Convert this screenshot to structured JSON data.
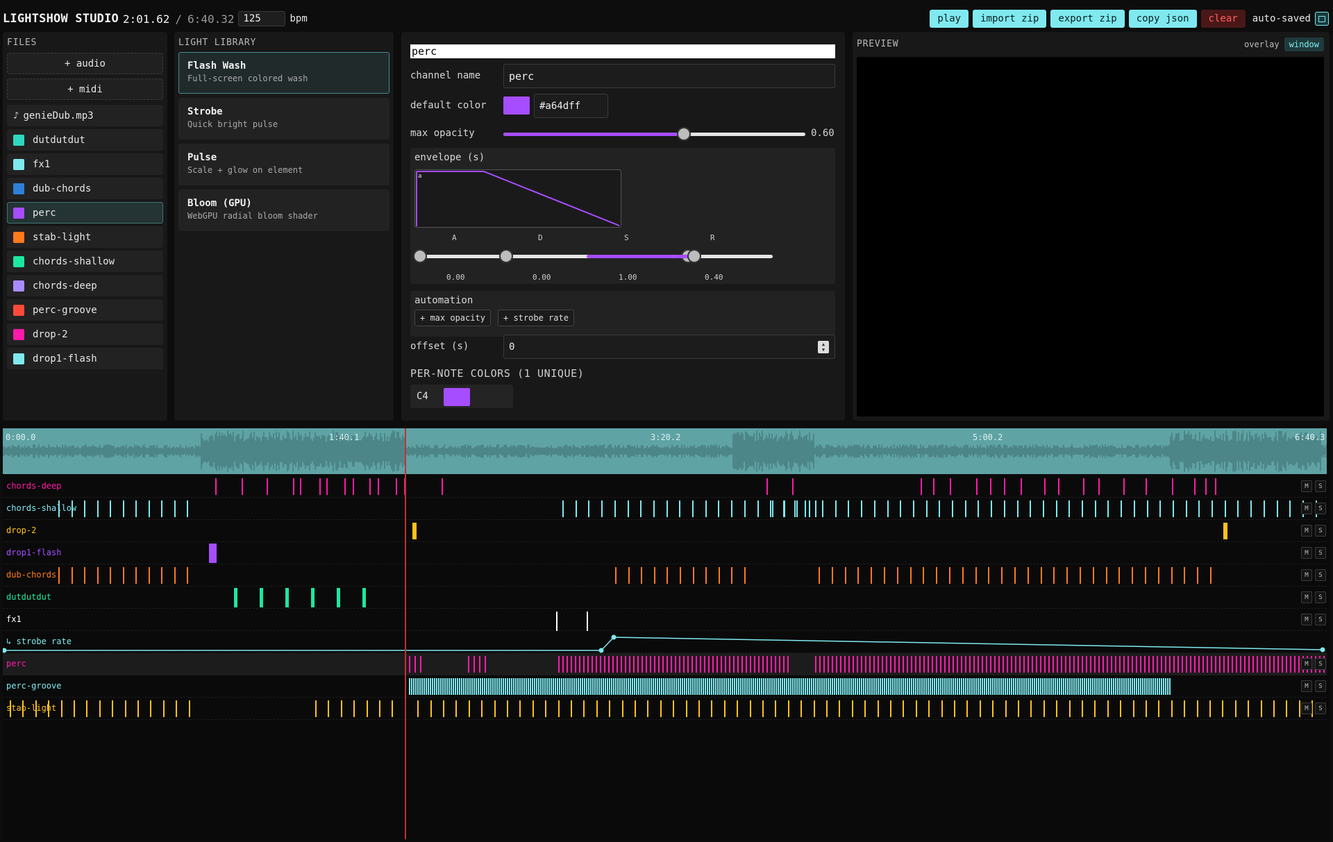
{
  "app": {
    "title": "LIGHTSHOW STUDIO",
    "current_time": "2:01.62",
    "separator": "/",
    "total_time": "6:40.32",
    "bpm": "125",
    "bpm_label": "bpm"
  },
  "toolbar": {
    "play": "play",
    "import_zip": "import zip",
    "export_zip": "export zip",
    "copy_json": "copy json",
    "clear": "clear",
    "status": "auto-saved"
  },
  "files": {
    "title": "FILES",
    "add_audio": "+ audio",
    "add_midi": "+ midi",
    "audio_file": "genieDub.mp3",
    "channels": [
      {
        "name": "dutdutdut",
        "color": "#2fd8c0"
      },
      {
        "name": "fx1",
        "color": "#7fe9ef"
      },
      {
        "name": "dub-chords",
        "color": "#2f7fd8"
      },
      {
        "name": "perc",
        "color": "#a64dff",
        "selected": true
      },
      {
        "name": "stab-light",
        "color": "#ff7a1a"
      },
      {
        "name": "chords-shallow",
        "color": "#1ce8a0"
      },
      {
        "name": "chords-deep",
        "color": "#a98bff"
      },
      {
        "name": "perc-groove",
        "color": "#ff4a3a"
      },
      {
        "name": "drop-2",
        "color": "#ff1aa8"
      },
      {
        "name": "drop1-flash",
        "color": "#7fe9ef"
      }
    ]
  },
  "library": {
    "title": "LIGHT LIBRARY",
    "items": [
      {
        "name": "Flash Wash",
        "desc": "Full-screen colored wash"
      },
      {
        "name": "Strobe",
        "desc": "Quick bright pulse"
      },
      {
        "name": "Pulse",
        "desc": "Scale + glow on element"
      },
      {
        "name": "Bloom (GPU)",
        "desc": "WebGPU radial bloom shader"
      }
    ]
  },
  "editor": {
    "header": "perc",
    "channel_name_label": "channel name",
    "channel_name": "perc",
    "default_color_label": "default color",
    "default_color": "#a64dff",
    "max_opacity_label": "max opacity",
    "max_opacity": "0.60",
    "envelope_label": "envelope (s)",
    "envelope_corner": "a",
    "adsr": [
      {
        "label": "A",
        "value": "0.00"
      },
      {
        "label": "D",
        "value": "0.00"
      },
      {
        "label": "S",
        "value": "1.00"
      },
      {
        "label": "R",
        "value": "0.40"
      }
    ],
    "automation_label": "automation",
    "automation_add_opacity": "+ max opacity",
    "automation_add_strobe": "+ strobe rate",
    "offset_label": "offset (s)",
    "offset_value": "0",
    "per_note_title": "PER-NOTE COLORS (1 UNIQUE)",
    "note": "C4",
    "note_color": "#a64dff"
  },
  "preview": {
    "title": "PREVIEW",
    "overlay": "overlay",
    "window": "window"
  },
  "timeline": {
    "time_labels": [
      "0:00.0",
      "1:40.1",
      "3:20.2",
      "5:00.2",
      "6:40.3"
    ],
    "mute": "M",
    "solo": "S",
    "tracks": [
      {
        "name": "chords-deep",
        "color": "#ff1aa8"
      },
      {
        "name": "chords-shallow",
        "color": "#7fe9ef"
      },
      {
        "name": "drop-2",
        "color": "#ffc21a"
      },
      {
        "name": "drop1-flash",
        "color": "#a64dff"
      },
      {
        "name": "dub-chords",
        "color": "#ff7a1a"
      },
      {
        "name": "dutdutdut",
        "color": "#1ce8a0"
      },
      {
        "name": "fx1",
        "color": "#ffffff"
      },
      {
        "name": "↳ strobe rate",
        "color": "#7fe9ef"
      },
      {
        "name": "perc",
        "color": "#ff1aa8"
      },
      {
        "name": "perc-groove",
        "color": "#7fe9ef"
      },
      {
        "name": "stab-light",
        "color": "#ffc21a"
      }
    ]
  }
}
